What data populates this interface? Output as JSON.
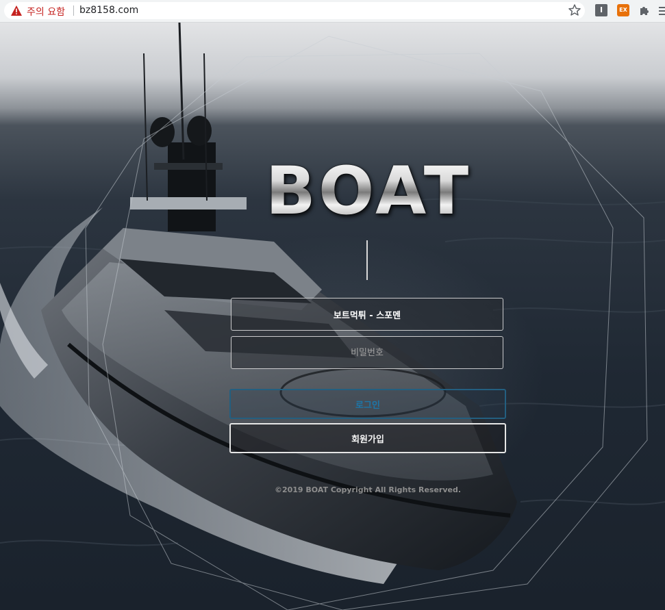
{
  "browser": {
    "security_warning": "주의 요함",
    "url": "bz8158.com",
    "extensions": [
      "I",
      "EX"
    ],
    "icons": [
      "warning-icon",
      "bookmark-star-icon",
      "extension-i-icon",
      "extension-ex-icon",
      "extensions-puzzle-icon",
      "menu-icon"
    ]
  },
  "page": {
    "logo_text": "BOAT",
    "username_value": "보트먹튀 - 스포멘",
    "password_placeholder": "비밀번호",
    "login_label": "로그인",
    "signup_label": "회원가입",
    "copyright": "©2019 BOAT Copyright All Rights Reserved.",
    "colors": {
      "login_border": "#235f80",
      "login_text": "#1d76a8",
      "warning_red": "#c5221f"
    }
  }
}
